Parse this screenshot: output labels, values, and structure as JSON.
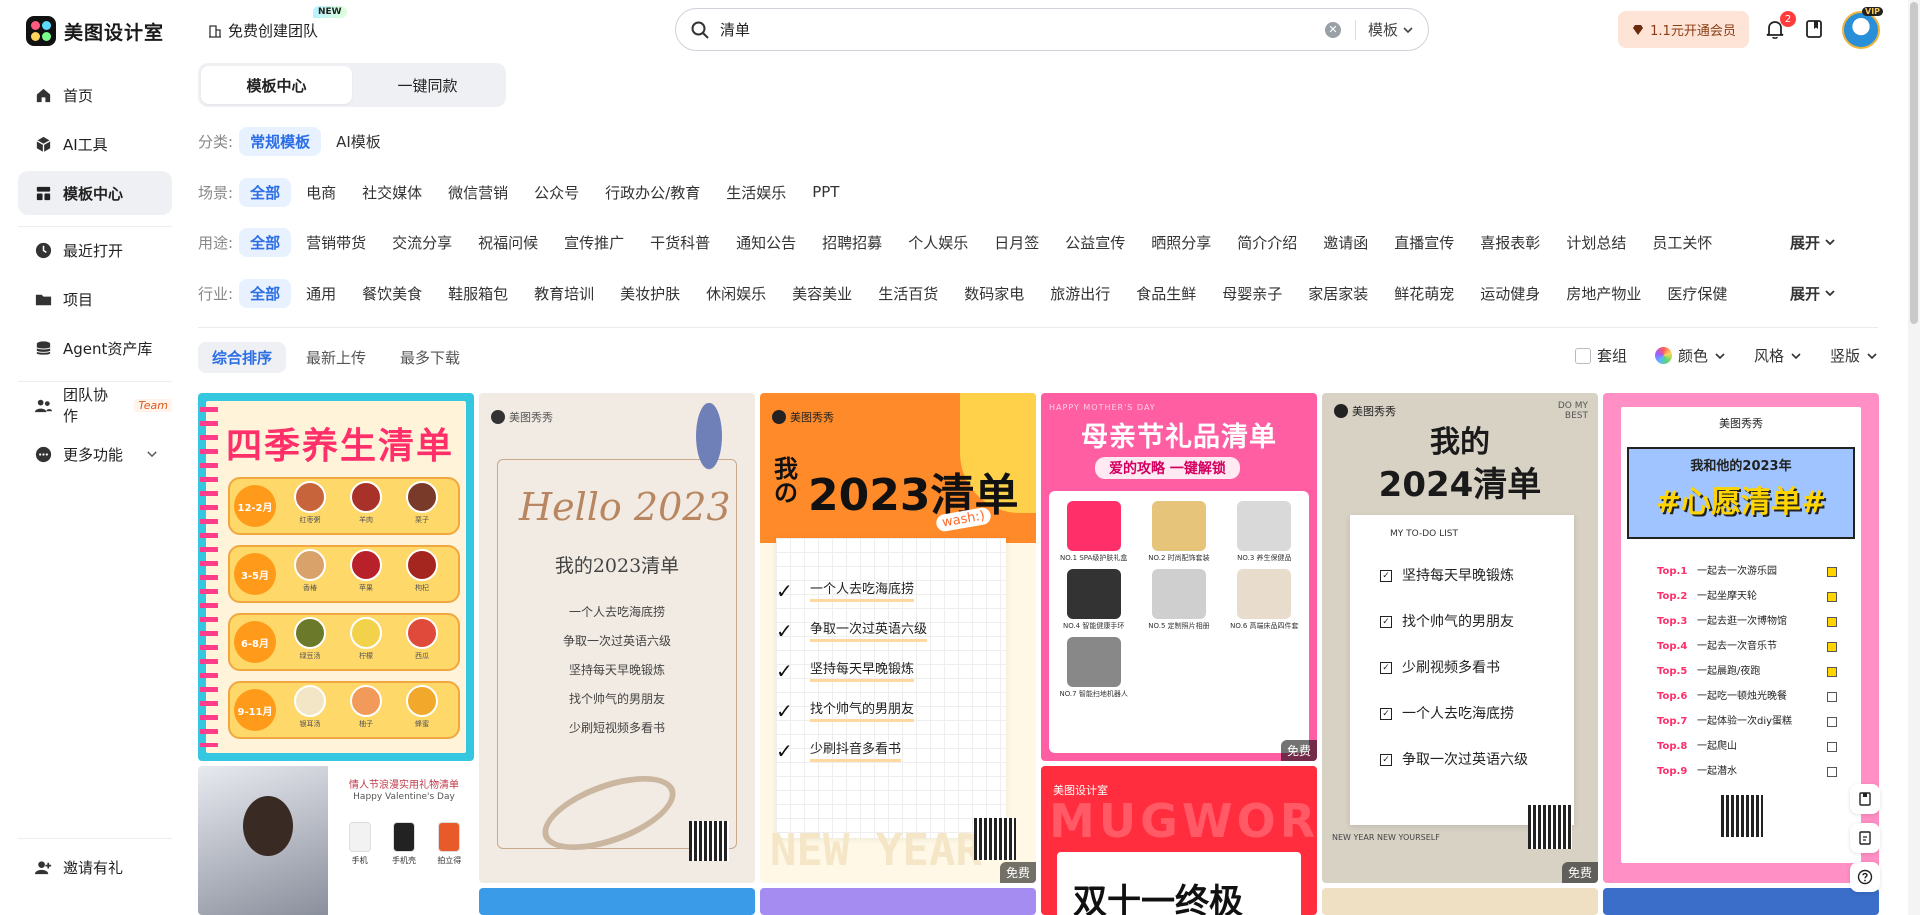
{
  "app": {
    "logo_text": "美图设计室",
    "create_team": "免费创建团队",
    "new_badge": "NEW"
  },
  "search": {
    "value": "清单",
    "type": "模板"
  },
  "header": {
    "vip_label": "1.1元开通会员",
    "notification_count": "2",
    "avatar_vip": "VIP"
  },
  "sidebar": {
    "items": [
      {
        "label": "首页",
        "icon": "home-icon"
      },
      {
        "label": "AI工具",
        "icon": "ai-cube-icon"
      },
      {
        "label": "模板中心",
        "icon": "template-grid-icon"
      },
      {
        "label": "最近打开",
        "icon": "clock-icon"
      },
      {
        "label": "项目",
        "icon": "folder-icon"
      },
      {
        "label": "Agent资产库",
        "icon": "database-icon"
      },
      {
        "label": "团队协作",
        "icon": "team-icon",
        "tag": "Team"
      },
      {
        "label": "更多功能",
        "icon": "more-icon"
      }
    ],
    "invite": "邀请有礼"
  },
  "tabs": [
    "模板中心",
    "一键同款"
  ],
  "filters": {
    "category": {
      "label": "分类:",
      "options": [
        "常规模板",
        "AI模板"
      ]
    },
    "scene": {
      "label": "场景:",
      "options": [
        "全部",
        "电商",
        "社交媒体",
        "微信营销",
        "公众号",
        "行政办公/教育",
        "生活娱乐",
        "PPT"
      ]
    },
    "usage": {
      "label": "用途:",
      "options": [
        "全部",
        "营销带货",
        "交流分享",
        "祝福问候",
        "宣传推广",
        "干货科普",
        "通知公告",
        "招聘招募",
        "个人娱乐",
        "日月签",
        "公益宣传",
        "晒照分享",
        "简介介绍",
        "邀请函",
        "直播宣传",
        "喜报表彰",
        "计划总结",
        "员工关怀"
      ]
    },
    "industry": {
      "label": "行业:",
      "options": [
        "全部",
        "通用",
        "餐饮美食",
        "鞋服箱包",
        "教育培训",
        "美妆护肤",
        "休闲娱乐",
        "美容美业",
        "生活百货",
        "数码家电",
        "旅游出行",
        "食品生鲜",
        "母婴亲子",
        "家居家装",
        "鲜花萌宠",
        "运动健身",
        "房地产物业",
        "医疗保健"
      ]
    },
    "expand": "展开"
  },
  "sort": {
    "options": [
      "综合排序",
      "最新上传",
      "最多下载"
    ],
    "tools": [
      "套组",
      "颜色",
      "风格",
      "竖版"
    ]
  },
  "cards": {
    "free": "免费",
    "brand": "美图秀秀",
    "brand2": "美图设计室",
    "c1": {
      "title": "四季养生清单",
      "seasons": [
        "12-2月",
        "3-5月",
        "6-8月",
        "9-11月"
      ],
      "foods": [
        [
          "红枣粥",
          "羊肉",
          "栗子"
        ],
        [
          "香椿",
          "苹果",
          "枸杞"
        ],
        [
          "绿豆汤",
          "柠檬",
          "西瓜"
        ],
        [
          "银耳汤",
          "柚子",
          "蜂蜜"
        ]
      ]
    },
    "c2": {
      "script": "Hello 2023",
      "title": "我的2023清单",
      "items": [
        "一个人去吃海底捞",
        "争取一次过英语六级",
        "坚持每天早晚锻炼",
        "找个帅气的男朋友",
        "少刷短视频多看书"
      ]
    },
    "c3": {
      "title_a": "我の",
      "title_b": "2023清单",
      "wash": "wash:)",
      "items": [
        "一个人去吃海底捞",
        "争取一次过英语六级",
        "坚持每天早晚锻炼",
        "找个帅气的男朋友",
        "少刷抖音多看书"
      ],
      "bg_text": "NEW YEAR"
    },
    "c4": {
      "top": "HAPPY MOTHER'S DAY",
      "title": "母亲节礼品清单",
      "sub": "爱的攻略 一键解锁",
      "products": [
        "NO.1 SPA级护肤礼盒",
        "NO.2 时尚配饰套装",
        "NO.3 养生保健品",
        "NO.4 智能健康手环",
        "NO.5 定制照片相册",
        "NO.6 高端床品四件套",
        "NO.7 智能扫地机器人"
      ]
    },
    "c5": {
      "corner": "DO MY BEST",
      "title_a": "我的",
      "title_b": "2024清单",
      "list_head": "MY TO-DO LIST",
      "items": [
        "坚持每天早晚锻炼",
        "找个帅气的男朋友",
        "少刷视频多看书",
        "一个人去吃海底捞",
        "争取一次过英语六级"
      ],
      "foot": "NEW YEAR NEW YOURSELF"
    },
    "c6": {
      "banner": "我和他的2023年",
      "title": "#心愿清单#",
      "items": [
        [
          "Top.1",
          "一起去一次游乐园"
        ],
        [
          "Top.2",
          "一起坐摩天轮"
        ],
        [
          "Top.3",
          "一起去逛一次博物馆"
        ],
        [
          "Top.4",
          "一起去一次音乐节"
        ],
        [
          "Top.5",
          "一起晨跑/夜跑"
        ],
        [
          "Top.6",
          "一起吃一顿烛光晚餐"
        ],
        [
          "Top.7",
          "一起体验一次diy蛋糕"
        ],
        [
          "Top.8",
          "一起爬山"
        ],
        [
          "Top.9",
          "一起潜水"
        ]
      ]
    },
    "c7": {
      "title": "情人节浪漫实用礼物清单",
      "sub": "Happy Valentine's Day",
      "items": [
        "手机",
        "手机壳",
        "拍立得"
      ]
    },
    "c8": {
      "deco": "MUGWOR",
      "title": "双十一终极"
    }
  },
  "colors": {
    "accent": "#2b6ee6",
    "vip_bg": "#fde4d7",
    "active_nav_bg": "#eef0f3"
  }
}
